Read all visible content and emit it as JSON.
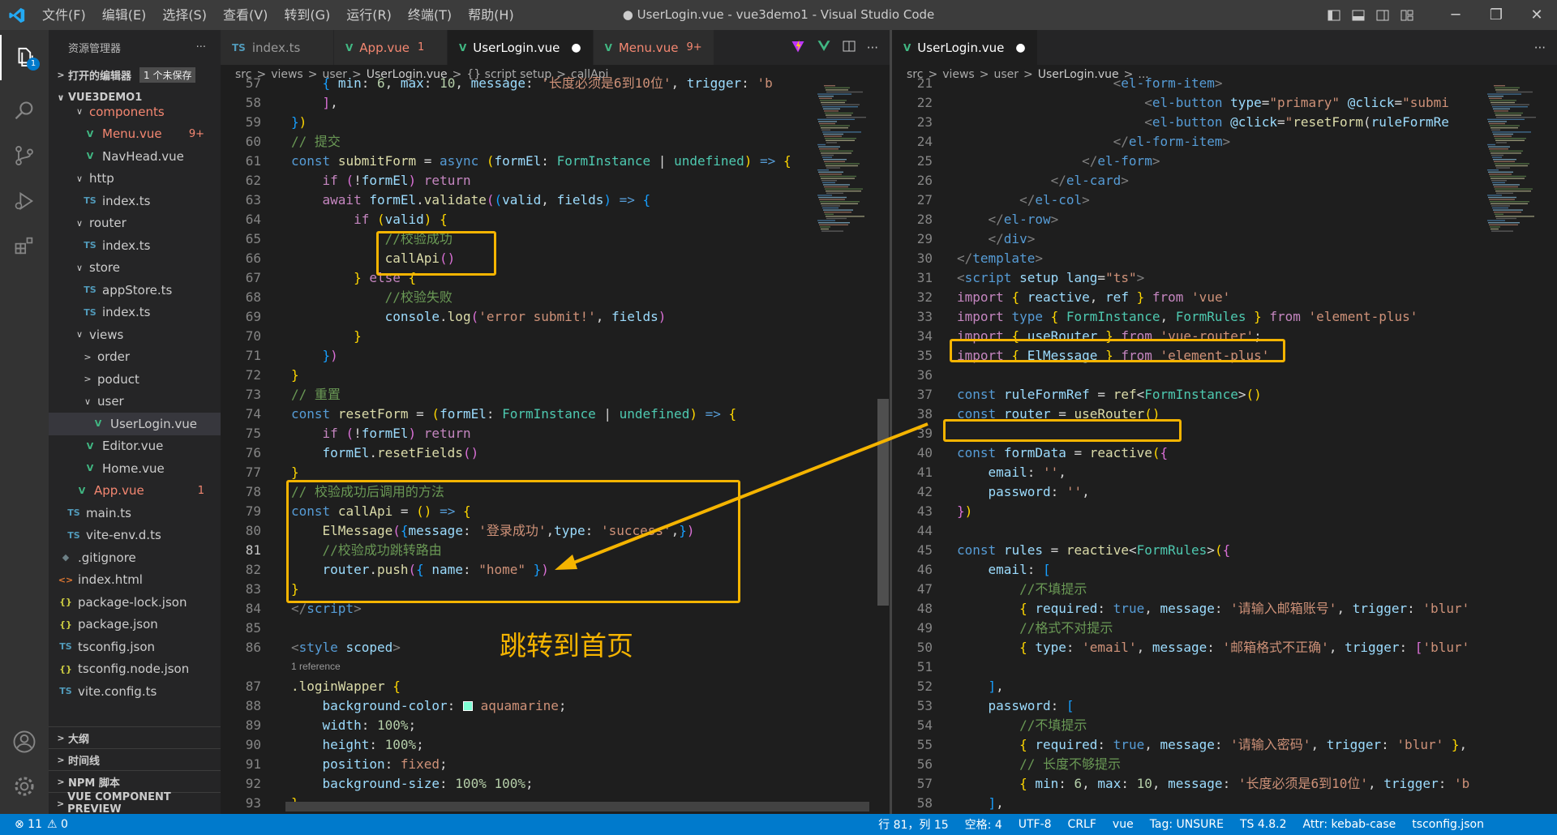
{
  "titlebar": {
    "menus": [
      "文件(F)",
      "编辑(E)",
      "选择(S)",
      "查看(V)",
      "转到(G)",
      "运行(R)",
      "终端(T)",
      "帮助(H)"
    ],
    "title": "● UserLogin.vue - vue3demo1 - Visual Studio Code"
  },
  "activity": {
    "explorer_badge": "1"
  },
  "sidebar": {
    "header": "资源管理器",
    "more": "···",
    "open_editors": "打开的编辑器",
    "unsaved": "1 个未保存",
    "project": "VUE3DEMO1",
    "tree": [
      {
        "label": "components",
        "icon": "",
        "chev": "∨",
        "indent": 30,
        "cls": "red"
      },
      {
        "label": "Menu.vue",
        "icon": "V",
        "ic": "vue",
        "chev": "",
        "indent": 40,
        "cls": "red",
        "count": "9+"
      },
      {
        "label": "NavHead.vue",
        "icon": "V",
        "ic": "vue",
        "chev": "",
        "indent": 40
      },
      {
        "label": "http",
        "icon": "",
        "chev": "∨",
        "indent": 30
      },
      {
        "label": "index.ts",
        "icon": "TS",
        "ic": "ts",
        "chev": "",
        "indent": 40
      },
      {
        "label": "router",
        "icon": "",
        "chev": "∨",
        "indent": 30
      },
      {
        "label": "index.ts",
        "icon": "TS",
        "ic": "ts",
        "chev": "",
        "indent": 40
      },
      {
        "label": "store",
        "icon": "",
        "chev": "∨",
        "indent": 30
      },
      {
        "label": "appStore.ts",
        "icon": "TS",
        "ic": "ts",
        "chev": "",
        "indent": 40
      },
      {
        "label": "index.ts",
        "icon": "TS",
        "ic": "ts",
        "chev": "",
        "indent": 40
      },
      {
        "label": "views",
        "icon": "",
        "chev": "∨",
        "indent": 30
      },
      {
        "label": "order",
        "icon": "",
        "chev": ">",
        "indent": 40
      },
      {
        "label": "poduct",
        "icon": "",
        "chev": ">",
        "indent": 40
      },
      {
        "label": "user",
        "icon": "",
        "chev": "∨",
        "indent": 40
      },
      {
        "label": "UserLogin.vue",
        "icon": "V",
        "ic": "vue",
        "chev": "",
        "indent": 50,
        "sel": true
      },
      {
        "label": "Editor.vue",
        "icon": "V",
        "ic": "vue",
        "chev": "",
        "indent": 40
      },
      {
        "label": "Home.vue",
        "icon": "V",
        "ic": "vue",
        "chev": "",
        "indent": 40
      },
      {
        "label": "App.vue",
        "icon": "V",
        "ic": "vue",
        "chev": "",
        "indent": 30,
        "cls": "red",
        "count": "1"
      },
      {
        "label": "main.ts",
        "icon": "TS",
        "ic": "ts",
        "chev": "",
        "indent": 20
      },
      {
        "label": "vite-env.d.ts",
        "icon": "TS",
        "ic": "ts",
        "chev": "",
        "indent": 20
      },
      {
        "label": ".gitignore",
        "icon": "◆",
        "ic": "git",
        "chev": "",
        "indent": 10
      },
      {
        "label": "index.html",
        "icon": "<>",
        "ic": "html",
        "chev": "",
        "indent": 10
      },
      {
        "label": "package-lock.json",
        "icon": "{}",
        "ic": "json",
        "chev": "",
        "indent": 10
      },
      {
        "label": "package.json",
        "icon": "{}",
        "ic": "json",
        "chev": "",
        "indent": 10
      },
      {
        "label": "tsconfig.json",
        "icon": "TS",
        "ic": "ts",
        "chev": "",
        "indent": 10
      },
      {
        "label": "tsconfig.node.json",
        "icon": "{}",
        "ic": "json",
        "chev": "",
        "indent": 10
      },
      {
        "label": "vite.config.ts",
        "icon": "TS",
        "ic": "ts",
        "chev": "",
        "indent": 10
      }
    ],
    "bottom_sections": [
      "大纲",
      "时间线",
      "NPM 脚本",
      "VUE COMPONENT PREVIEW"
    ]
  },
  "editor1": {
    "tabs": [
      {
        "label": "index.ts",
        "icon": "TS",
        "ic": "ts"
      },
      {
        "label": "App.vue",
        "icon": "V",
        "ic": "vue",
        "num": "1",
        "warn": true
      },
      {
        "label": "UserLogin.vue",
        "icon": "V",
        "ic": "vue",
        "active": true,
        "dot": "●"
      },
      {
        "label": "Menu.vue",
        "icon": "V",
        "ic": "vue",
        "num": "9+",
        "warn": true
      }
    ],
    "breadcrumbs": [
      "src",
      ">",
      "views",
      ">",
      "user",
      ">",
      "UserLogin.vue",
      ">",
      "{} script setup",
      ">",
      "callApi"
    ],
    "reference": "1 reference",
    "lines": [
      {
        "n": "57",
        "h": "    <span class=\"b3\">{</span> <span class=\"prop\">min</span>: <span class=\"n\">6</span>, <span class=\"prop\">max</span>: <span class=\"n\">10</span>, <span class=\"prop\">message</span>: <span class=\"s\">'长度必须是6到10位'</span>, <span class=\"prop\">trigger</span>: <span class=\"s\">'b</span>"
      },
      {
        "n": "58",
        "h": "    <span class=\"b2\">]</span>,"
      },
      {
        "n": "59",
        "h": "<span class=\"b3\">}</span><span class=\"b1\">)</span>"
      },
      {
        "n": "60",
        "h": "<span class=\"c\">// 提交</span>"
      },
      {
        "n": "61",
        "h": "<span class=\"k\">const</span> <span class=\"f\">submitForm</span> = <span class=\"k\">async</span> <span class=\"b1\">(</span><span class=\"v\">formEl</span>: <span class=\"t\">FormInstance</span> | <span class=\"t\">undefined</span><span class=\"b1\">)</span> <span class=\"k\">=&gt;</span> <span class=\"b1\">{</span>"
      },
      {
        "n": "62",
        "h": "    <span class=\"kc\">if</span> <span class=\"b2\">(</span>!<span class=\"v\">formEl</span><span class=\"b2\">)</span> <span class=\"kc\">return</span>"
      },
      {
        "n": "63",
        "h": "    <span class=\"kc\">await</span> <span class=\"v\">formEl</span>.<span class=\"f\">validate</span><span class=\"b2\">(</span><span class=\"b3\">(</span><span class=\"v\">valid</span>, <span class=\"v\">fields</span><span class=\"b3\">)</span> <span class=\"k\">=&gt;</span> <span class=\"b3\">{</span>"
      },
      {
        "n": "64",
        "h": "        <span class=\"kc\">if</span> <span class=\"b1\">(</span><span class=\"v\">valid</span><span class=\"b1\">)</span> <span class=\"b1\">{</span>"
      },
      {
        "n": "65",
        "h": "            <span class=\"c\">//校验成功</span>"
      },
      {
        "n": "66",
        "h": "            <span class=\"f\">callApi</span><span class=\"b2\">()</span>"
      },
      {
        "n": "67",
        "h": "        <span class=\"b1\">}</span> <span class=\"kc\">else</span> <span class=\"b1\">{</span>"
      },
      {
        "n": "68",
        "h": "            <span class=\"c\">//校验失败</span>"
      },
      {
        "n": "69",
        "h": "            <span class=\"v\">console</span>.<span class=\"f\">log</span><span class=\"b2\">(</span><span class=\"s\">'error submit!'</span>, <span class=\"v\">fields</span><span class=\"b2\">)</span>"
      },
      {
        "n": "70",
        "h": "        <span class=\"b1\">}</span>"
      },
      {
        "n": "71",
        "h": "    <span class=\"b3\">}</span><span class=\"b2\">)</span>"
      },
      {
        "n": "72",
        "h": "<span class=\"b1\">}</span>"
      },
      {
        "n": "73",
        "h": "<span class=\"c\">// 重置</span>"
      },
      {
        "n": "74",
        "h": "<span class=\"k\">const</span> <span class=\"f\">resetForm</span> = <span class=\"b1\">(</span><span class=\"v\">formEl</span>: <span class=\"t\">FormInstance</span> | <span class=\"t\">undefined</span><span class=\"b1\">)</span> <span class=\"k\">=&gt;</span> <span class=\"b1\">{</span>"
      },
      {
        "n": "75",
        "h": "    <span class=\"kc\">if</span> <span class=\"b2\">(</span>!<span class=\"v\">formEl</span><span class=\"b2\">)</span> <span class=\"kc\">return</span>"
      },
      {
        "n": "76",
        "h": "    <span class=\"v\">formEl</span>.<span class=\"f\">resetFields</span><span class=\"b2\">()</span>"
      },
      {
        "n": "77",
        "h": "<span class=\"b1\">}</span>"
      },
      {
        "n": "78",
        "h": "<span class=\"c\">// 校验成功后调用的方法</span>"
      },
      {
        "n": "79",
        "h": "<span class=\"k\">const</span> <span class=\"f\">callApi</span> = <span class=\"b1\">()</span> <span class=\"k\">=&gt;</span> <span class=\"b1\">{</span>"
      },
      {
        "n": "80",
        "h": "    <span class=\"f\">ElMessage</span><span class=\"b2\">(</span><span class=\"b3\">{</span><span class=\"prop\">message</span>: <span class=\"s\">'登录成功'</span>,<span class=\"prop\">type</span>: <span class=\"s\">'success'</span>,<span class=\"b3\">}</span><span class=\"b2\">)</span>"
      },
      {
        "n": "81",
        "h": "    <span class=\"c\">//校验成功跳转路由</span>",
        "cur": true
      },
      {
        "n": "82",
        "h": "    <span class=\"v\">router</span>.<span class=\"f\">push</span><span class=\"b2\">(</span><span class=\"b3\">{</span> <span class=\"prop\">name</span>: <span class=\"s\">\"home\"</span> <span class=\"b3\">}</span><span class=\"b2\">)</span>"
      },
      {
        "n": "83",
        "h": "<span class=\"b1\">}</span>"
      },
      {
        "n": "84",
        "h": "<span class=\"p\">&lt;/</span><span class=\"tag\">script</span><span class=\"p\">&gt;</span>"
      },
      {
        "n": "85",
        "h": ""
      },
      {
        "n": "86",
        "h": "<span class=\"p\">&lt;</span><span class=\"tag\">style</span> <span class=\"attr\">scoped</span><span class=\"p\">&gt;</span>"
      },
      {
        "n": "87",
        "h": "<span class=\"f\">.loginWapper</span> <span class=\"b1\">{</span>",
        "ref": true
      },
      {
        "n": "88",
        "h": "    <span class=\"prop\">background-color</span>: <span style=\"display:inline-block;width:12px;height:12px;background:#7fffd4;border:1px solid #fff;vertical-align:-1px\"></span> <span class=\"s\">aquamarine</span>;"
      },
      {
        "n": "89",
        "h": "    <span class=\"prop\">width</span>: <span class=\"n\">100%</span>;"
      },
      {
        "n": "90",
        "h": "    <span class=\"prop\">height</span>: <span class=\"n\">100%</span>;"
      },
      {
        "n": "91",
        "h": "    <span class=\"prop\">position</span>: <span class=\"s\">fixed</span>;"
      },
      {
        "n": "92",
        "h": "    <span class=\"prop\">background-size</span>: <span class=\"n\">100%</span> <span class=\"n\">100%</span>;"
      },
      {
        "n": "93",
        "h": "<span class=\"b1\">}</span>"
      }
    ]
  },
  "editor2": {
    "tabs": [
      {
        "label": "UserLogin.vue",
        "icon": "V",
        "ic": "vue",
        "active": true,
        "dot": "●"
      }
    ],
    "breadcrumbs": [
      "src",
      ">",
      "views",
      ">",
      "user",
      ">",
      "UserLogin.vue",
      ">",
      "..."
    ],
    "lines": [
      {
        "n": "21",
        "h": "                    <span class=\"p\">&lt;</span><span class=\"tag\">el-form-item</span><span class=\"p\">&gt;</span>"
      },
      {
        "n": "22",
        "h": "                        <span class=\"p\">&lt;</span><span class=\"tag\">el-button</span> <span class=\"attr\">type</span>=<span class=\"s\">\"primary\"</span> <span class=\"attr\">@click</span>=<span class=\"s\">\"submi</span>"
      },
      {
        "n": "23",
        "h": "                        <span class=\"p\">&lt;</span><span class=\"tag\">el-button</span> <span class=\"attr\">@click</span>=<span class=\"s\">\"</span><span class=\"f\">resetForm</span>(<span class=\"v\">ruleFormRe</span>"
      },
      {
        "n": "24",
        "h": "                    <span class=\"p\">&lt;/</span><span class=\"tag\">el-form-item</span><span class=\"p\">&gt;</span>"
      },
      {
        "n": "25",
        "h": "                <span class=\"p\">&lt;/</span><span class=\"tag\">el-form</span><span class=\"p\">&gt;</span>"
      },
      {
        "n": "26",
        "h": "            <span class=\"p\">&lt;/</span><span class=\"tag\">el-card</span><span class=\"p\">&gt;</span>"
      },
      {
        "n": "27",
        "h": "        <span class=\"p\">&lt;/</span><span class=\"tag\">el-col</span><span class=\"p\">&gt;</span>"
      },
      {
        "n": "28",
        "h": "    <span class=\"p\">&lt;/</span><span class=\"tag\">el-row</span><span class=\"p\">&gt;</span>"
      },
      {
        "n": "29",
        "h": "    <span class=\"p\">&lt;/</span><span class=\"tag\">div</span><span class=\"p\">&gt;</span>"
      },
      {
        "n": "30",
        "h": "<span class=\"p\">&lt;/</span><span class=\"tag\">template</span><span class=\"p\">&gt;</span>"
      },
      {
        "n": "31",
        "h": "<span class=\"p\">&lt;</span><span class=\"tag\">script</span> <span class=\"attr\">setup</span> <span class=\"attr\">lang</span>=<span class=\"s\">\"ts\"</span><span class=\"p\">&gt;</span>"
      },
      {
        "n": "32",
        "h": "<span class=\"kc\">import</span> <span class=\"b1\">{</span> <span class=\"v\">reactive</span>, <span class=\"v\">ref</span> <span class=\"b1\">}</span> <span class=\"kc\">from</span> <span class=\"s\">'vue'</span>"
      },
      {
        "n": "33",
        "h": "<span class=\"kc\">import</span> <span class=\"k\">type</span> <span class=\"b1\">{</span> <span class=\"t\">FormInstance</span>, <span class=\"t\">FormRules</span> <span class=\"b1\">}</span> <span class=\"kc\">from</span> <span class=\"s\">'element-plus'</span>"
      },
      {
        "n": "34",
        "h": "<span class=\"kc\">import</span> <span class=\"b1\">{</span> <span class=\"v\">useRouter</span> <span class=\"b1\">}</span> <span class=\"kc\">from</span> <span class=\"s\">'vue-router'</span>;"
      },
      {
        "n": "35",
        "h": "<span class=\"kc\">import</span> <span class=\"b1\">{</span> <span class=\"v\">ElMessage</span> <span class=\"b1\">}</span> <span class=\"kc\">from</span> <span class=\"s\">'element-plus'</span>"
      },
      {
        "n": "36",
        "h": ""
      },
      {
        "n": "37",
        "h": "<span class=\"k\">const</span> <span class=\"v\">ruleFormRef</span> = <span class=\"f\">ref</span>&lt;<span class=\"t\">FormInstance</span>&gt;<span class=\"b1\">()</span>"
      },
      {
        "n": "38",
        "h": "<span class=\"k\">const</span> <span class=\"v\">router</span> = <span class=\"f\">useRouter</span><span class=\"b1\">()</span>"
      },
      {
        "n": "39",
        "h": ""
      },
      {
        "n": "40",
        "h": "<span class=\"k\">const</span> <span class=\"v\">formData</span> = <span class=\"f\">reactive</span><span class=\"b1\">(</span><span class=\"b2\">{</span>"
      },
      {
        "n": "41",
        "h": "    <span class=\"prop\">email</span>: <span class=\"s\">''</span>,"
      },
      {
        "n": "42",
        "h": "    <span class=\"prop\">password</span>: <span class=\"s\">''</span>,"
      },
      {
        "n": "43",
        "h": "<span class=\"b2\">}</span><span class=\"b1\">)</span>"
      },
      {
        "n": "44",
        "h": ""
      },
      {
        "n": "45",
        "h": "<span class=\"k\">const</span> <span class=\"v\">rules</span> = <span class=\"f\">reactive</span>&lt;<span class=\"t\">FormRules</span>&gt;<span class=\"b1\">(</span><span class=\"b2\">{</span>"
      },
      {
        "n": "46",
        "h": "    <span class=\"prop\">email</span>: <span class=\"b3\">[</span>"
      },
      {
        "n": "47",
        "h": "        <span class=\"c\">//不填提示</span>"
      },
      {
        "n": "48",
        "h": "        <span class=\"b1\">{</span> <span class=\"prop\">required</span>: <span class=\"k\">true</span>, <span class=\"prop\">message</span>: <span class=\"s\">'请输入邮箱账号'</span>, <span class=\"prop\">trigger</span>: <span class=\"s\">'blur'</span>"
      },
      {
        "n": "49",
        "h": "        <span class=\"c\">//格式不对提示</span>"
      },
      {
        "n": "50",
        "h": "        <span class=\"b1\">{</span> <span class=\"prop\">type</span>: <span class=\"s\">'email'</span>, <span class=\"prop\">message</span>: <span class=\"s\">'邮箱格式不正确'</span>, <span class=\"prop\">trigger</span>: <span class=\"b2\">[</span><span class=\"s\">'blur'</span>"
      },
      {
        "n": "51",
        "h": ""
      },
      {
        "n": "52",
        "h": "    <span class=\"b3\">]</span>,"
      },
      {
        "n": "53",
        "h": "    <span class=\"prop\">password</span>: <span class=\"b3\">[</span>"
      },
      {
        "n": "54",
        "h": "        <span class=\"c\">//不填提示</span>"
      },
      {
        "n": "55",
        "h": "        <span class=\"b1\">{</span> <span class=\"prop\">required</span>: <span class=\"k\">true</span>, <span class=\"prop\">message</span>: <span class=\"s\">'请输入密码'</span>, <span class=\"prop\">trigger</span>: <span class=\"s\">'blur'</span> <span class=\"b1\">}</span>,"
      },
      {
        "n": "56",
        "h": "        <span class=\"c\">// 长度不够提示</span>"
      },
      {
        "n": "57",
        "h": "        <span class=\"b1\">{</span> <span class=\"prop\">min</span>: <span class=\"n\">6</span>, <span class=\"prop\">max</span>: <span class=\"n\">10</span>, <span class=\"prop\">message</span>: <span class=\"s\">'长度必须是6到10位'</span>, <span class=\"prop\">trigger</span>: <span class=\"s\">'b</span>"
      },
      {
        "n": "58",
        "h": "    <span class=\"b3\">]</span>,"
      }
    ]
  },
  "annotation": {
    "text": "跳转到首页",
    "color": "#f5b400"
  },
  "status": {
    "errors": "⊗ 11",
    "warnings": "⚠ 0",
    "items": [
      "行 81，列 15",
      "空格: 4",
      "UTF-8",
      "CRLF",
      "vue",
      "Tag: UNSURE",
      "TS 4.8.2",
      "Attr: kebab-case",
      "tsconfig.json"
    ]
  },
  "colors": {
    "accent": "#007acc",
    "highlight": "#f5b400"
  }
}
